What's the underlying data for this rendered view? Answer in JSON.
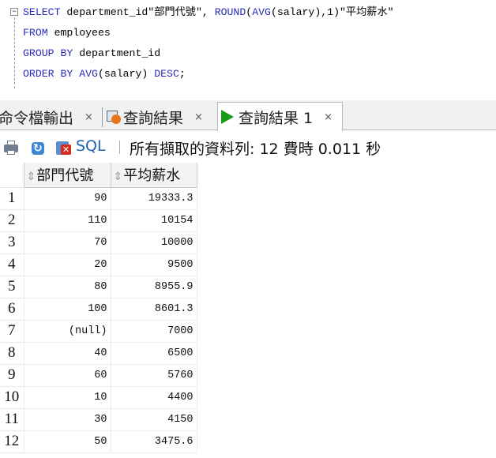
{
  "editor": {
    "fold_glyph": "−",
    "lines": [
      [
        {
          "t": "SELECT",
          "k": "kw"
        },
        {
          "t": " department_id\"部門代號\", ",
          "k": "str"
        },
        {
          "t": "ROUND",
          "k": "kw"
        },
        {
          "t": "(",
          "k": "str"
        },
        {
          "t": "AVG",
          "k": "kw"
        },
        {
          "t": "(salary),1)\"平均薪水\"",
          "k": "str"
        }
      ],
      [
        {
          "t": "FROM",
          "k": "kw"
        },
        {
          "t": " employees",
          "k": "str"
        }
      ],
      [
        {
          "t": "GROUP BY",
          "k": "kw"
        },
        {
          "t": " department_id",
          "k": "str"
        }
      ],
      [
        {
          "t": "ORDER BY",
          "k": "kw"
        },
        {
          "t": " ",
          "k": "str"
        },
        {
          "t": "AVG",
          "k": "kw"
        },
        {
          "t": "(salary) ",
          "k": "str"
        },
        {
          "t": "DESC",
          "k": "kw"
        },
        {
          "t": ";",
          "k": "str"
        }
      ]
    ]
  },
  "tabs": {
    "command_output": "命令檔輸出",
    "query_result": "查詢結果",
    "query_result_1": "查詢結果 1",
    "close_glyph": "×"
  },
  "toolbar": {
    "sql_label": "SQL",
    "status": "所有擷取的資料列: 12 費時 0.011 秒"
  },
  "grid": {
    "sort_glyph": "⇕",
    "columns": [
      "部門代號",
      "平均薪水"
    ],
    "rows": [
      {
        "n": "1",
        "dept": "90",
        "avg": "19333.3"
      },
      {
        "n": "2",
        "dept": "110",
        "avg": "10154"
      },
      {
        "n": "3",
        "dept": "70",
        "avg": "10000"
      },
      {
        "n": "4",
        "dept": "20",
        "avg": "9500"
      },
      {
        "n": "5",
        "dept": "80",
        "avg": "8955.9"
      },
      {
        "n": "6",
        "dept": "100",
        "avg": "8601.3"
      },
      {
        "n": "7",
        "dept": "(null)",
        "avg": "7000"
      },
      {
        "n": "8",
        "dept": "40",
        "avg": "6500"
      },
      {
        "n": "9",
        "dept": "60",
        "avg": "5760"
      },
      {
        "n": "10",
        "dept": "10",
        "avg": "4400"
      },
      {
        "n": "11",
        "dept": "30",
        "avg": "4150"
      },
      {
        "n": "12",
        "dept": "50",
        "avg": "3475.6"
      }
    ]
  },
  "colors": {
    "keyword": "#2b2bb8",
    "sql_link": "#1d62b7",
    "run_icon": "#1a9a1a"
  }
}
